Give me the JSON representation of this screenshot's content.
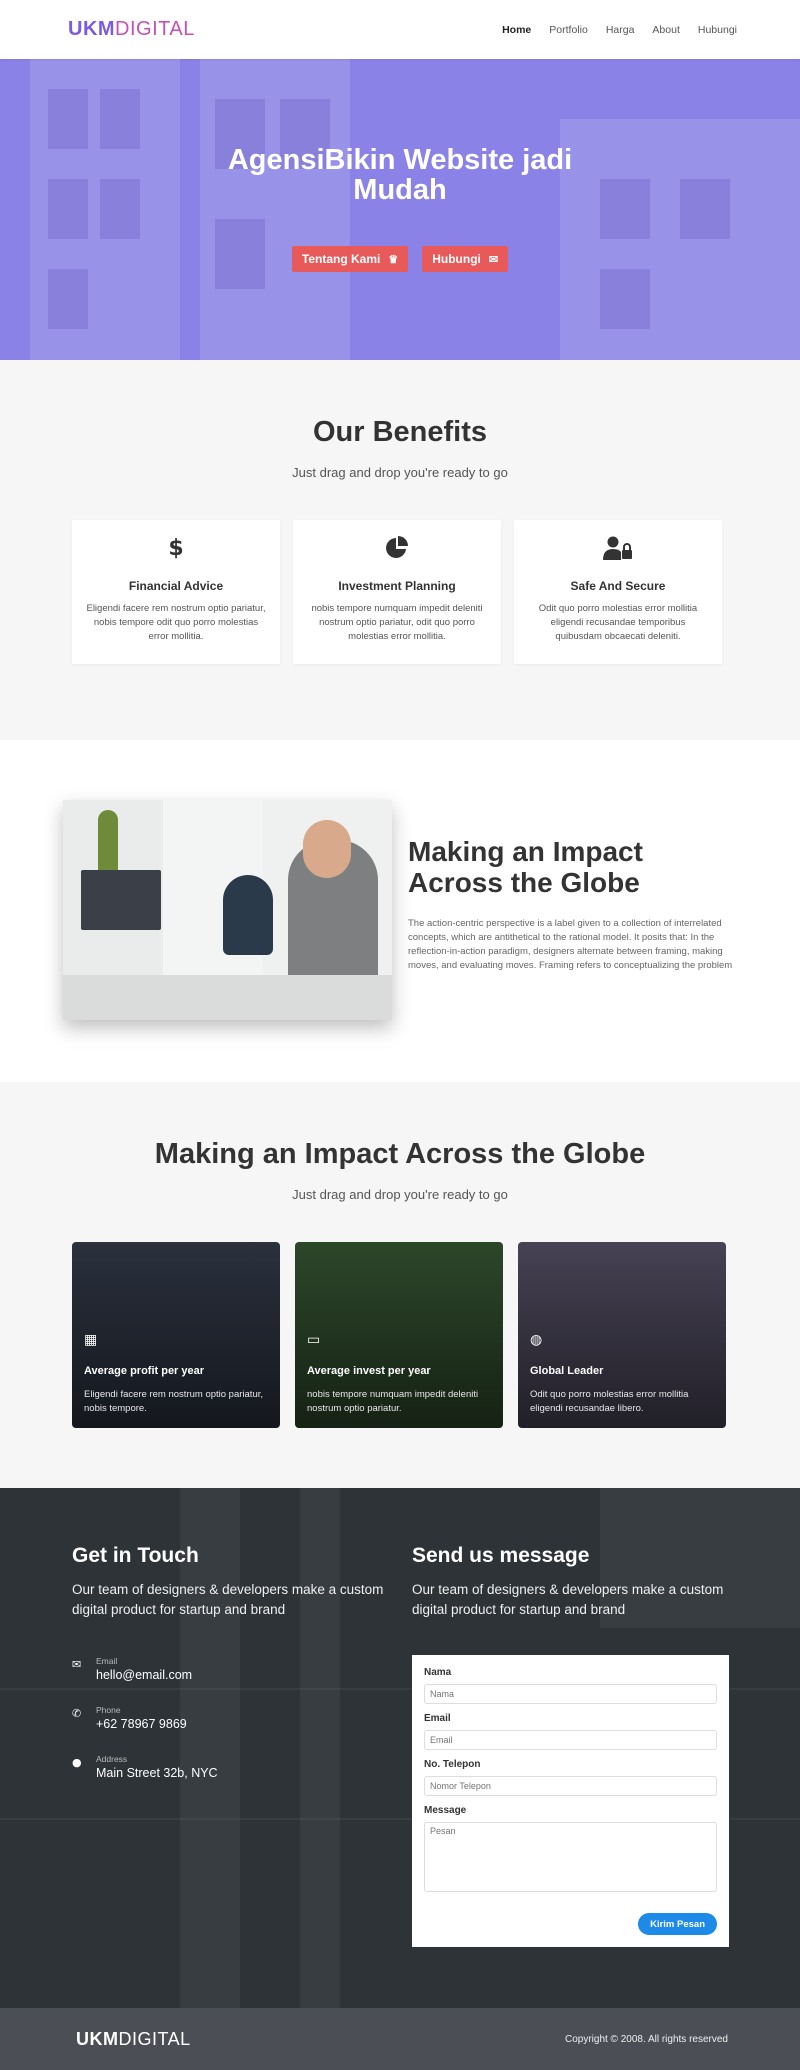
{
  "nav": {
    "logo_bold": "UKM",
    "logo_light": "DIGITAL",
    "links": [
      "Home",
      "Portfolio",
      "Harga",
      "About",
      "Hubungi"
    ]
  },
  "hero": {
    "title_line1": "AgensiBikin Website jadi",
    "title_line2": "Mudah",
    "btn_about": "Tentang Kami",
    "btn_contact": "Hubungi",
    "bg_color": "#8a82e6"
  },
  "benefits": {
    "title": "Our Benefits",
    "subtitle": "Just drag and drop you're ready to go",
    "cards": [
      {
        "icon": "dollar-icon",
        "title": "Financial Advice",
        "text": "Eligendi facere rem nostrum optio pariatur, nobis tempore odit quo porro molestias error mollitia."
      },
      {
        "icon": "pie-chart-icon",
        "title": "Investment Planning",
        "text": "nobis tempore numquam impedit deleniti nostrum optio pariatur, odit quo porro molestias error mollitia."
      },
      {
        "icon": "user-lock-icon",
        "title": "Safe And Secure",
        "text": "Odit quo porro molestias error mollitia eligendi recusandae temporibus quibusdam obcaecati deleniti."
      }
    ]
  },
  "impact": {
    "title_line1": "Making an Impact",
    "title_line2": "Across the Globe",
    "text": "The action-centric perspective is a label given to a collection of interrelated concepts, which are antithetical to the rational model. It posits that: In the reflection-in-action paradigm, designers alternate between framing, making moves, and evaluating moves. Framing refers to conceptualizing the problem"
  },
  "stats": {
    "title": "Making an Impact Across the Globe",
    "subtitle": "Just drag and drop you're ready to go",
    "cards": [
      {
        "icon": "grid-icon",
        "title": "Average profit per year",
        "text": "Eligendi facere rem nostrum optio pariatur, nobis tempore.",
        "bg": "#2c3340"
      },
      {
        "icon": "laptop-icon",
        "title": "Average invest per year",
        "text": "nobis tempore numquam impedit deleniti nostrum optio pariatur.",
        "bg": "#2f4a2c"
      },
      {
        "icon": "globe-icon",
        "title": "Global Leader",
        "text": "Odit quo porro molestias error mollitia eligendi recusandae libero.",
        "bg": "#4a4558"
      }
    ]
  },
  "contact": {
    "left_title": "Get in Touch",
    "left_lead": "Our team of designers & developers make a custom digital product for startup and brand",
    "right_title": "Send us message",
    "right_lead": "Our team of designers & developers make a custom digital product for startup and brand",
    "info": [
      {
        "icon": "envelope-icon",
        "label": "Email",
        "value": "hello@email.com"
      },
      {
        "icon": "phone-icon",
        "label": "Phone",
        "value": "+62 78967 9869"
      },
      {
        "icon": "map-marker-icon",
        "label": "Address",
        "value": "Main Street 32b, NYC"
      }
    ],
    "form": {
      "name_label": "Nama",
      "name_placeholder": "Nama",
      "email_label": "Email",
      "email_placeholder": "Email",
      "phone_label": "No. Telepon",
      "phone_placeholder": "Nomor Telepon",
      "message_label": "Message",
      "message_placeholder": "Pesan",
      "submit": "Kirim Pesan"
    }
  },
  "footer": {
    "logo_bold": "UKM",
    "logo_light": "DIGITAL",
    "copyright": "Copyright © 2008. All rights reserved"
  }
}
